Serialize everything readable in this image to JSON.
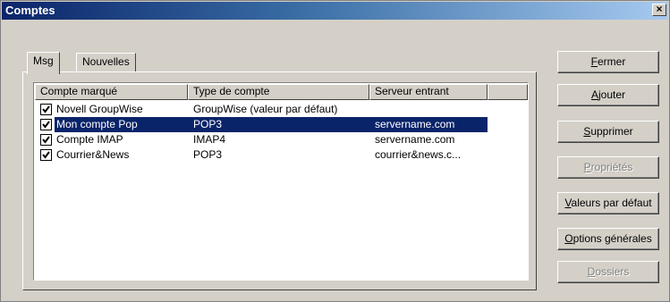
{
  "window": {
    "title": "Comptes",
    "close_glyph": "×"
  },
  "tabs": [
    {
      "label": "Msg",
      "active": true
    },
    {
      "label": "Nouvelles",
      "active": false
    }
  ],
  "list": {
    "columns": [
      "Compte marqué",
      "Type de compte",
      "Serveur entrant",
      ""
    ],
    "rows": [
      {
        "account": "Novell GroupWise",
        "type": "GroupWise (valeur par défaut)",
        "server": "",
        "checked": true,
        "selected": false
      },
      {
        "account": "Mon compte Pop",
        "type": "POP3",
        "server": "servername.com",
        "checked": true,
        "selected": true
      },
      {
        "account": "Compte IMAP",
        "type": "IMAP4",
        "server": "servername.com",
        "checked": true,
        "selected": false
      },
      {
        "account": "Courrier&News",
        "type": "POP3",
        "server": "courrier&news.c...",
        "checked": true,
        "selected": false
      }
    ]
  },
  "buttons": [
    {
      "label": "Fermer",
      "access_key": "F",
      "rest": "ermer",
      "enabled": true
    },
    {
      "label": "Ajouter",
      "access_key": "A",
      "rest": "jouter",
      "enabled": true
    },
    {
      "label": "Supprimer",
      "access_key": "S",
      "rest": "upprimer",
      "enabled": true
    },
    {
      "label": "Propriétés",
      "access_key": "P",
      "rest": "ropriétés",
      "enabled": false
    },
    {
      "label": "Valeurs par défaut",
      "access_key": "V",
      "rest": "aleurs par défaut",
      "enabled": true
    },
    {
      "label": "Options générales",
      "access_key": "O",
      "rest": "ptions générales",
      "enabled": true
    },
    {
      "label": "Dossiers",
      "access_key": "D",
      "rest": "ossiers",
      "enabled": false
    }
  ],
  "colors": {
    "selection": "#0a246a",
    "face": "#d4d0c8",
    "title_start": "#0a246a",
    "title_end": "#a6caf0"
  }
}
